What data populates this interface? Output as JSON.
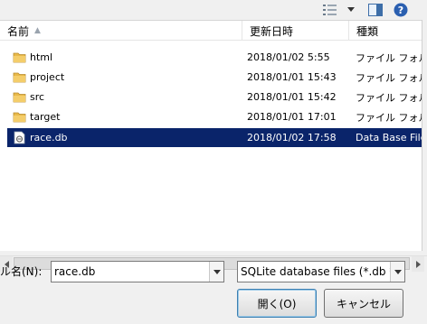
{
  "toolbar": {
    "views_icon": "views-icon",
    "views_dropdown_icon": "chevron-down-icon",
    "preview_pane_icon": "preview-pane-icon",
    "help_icon": "help-icon"
  },
  "columns": {
    "name": "名前",
    "date": "更新日時",
    "type": "種類"
  },
  "files": [
    {
      "name": "html",
      "date": "2018/01/02 5:55",
      "type": "ファイル フォルダー",
      "icon": "folder-icon",
      "selected": false
    },
    {
      "name": "project",
      "date": "2018/01/01 15:43",
      "type": "ファイル フォルダー",
      "icon": "folder-icon",
      "selected": false
    },
    {
      "name": "src",
      "date": "2018/01/01 15:42",
      "type": "ファイル フォルダー",
      "icon": "folder-icon",
      "selected": false
    },
    {
      "name": "target",
      "date": "2018/01/01 17:01",
      "type": "ファイル フォルダー",
      "icon": "folder-icon",
      "selected": false
    },
    {
      "name": "race.db",
      "date": "2018/01/02 17:58",
      "type": "Data Base File",
      "icon": "database-file-icon",
      "selected": true
    }
  ],
  "footer": {
    "filename_label": "ル名(N):",
    "filename_value": "race.db",
    "filter_value": "SQLite database files (*.db *",
    "open_label": "開く(O)",
    "cancel_label": "キャンセル"
  },
  "colors": {
    "selection": "#0a246a",
    "folder": "#e8b94a"
  }
}
